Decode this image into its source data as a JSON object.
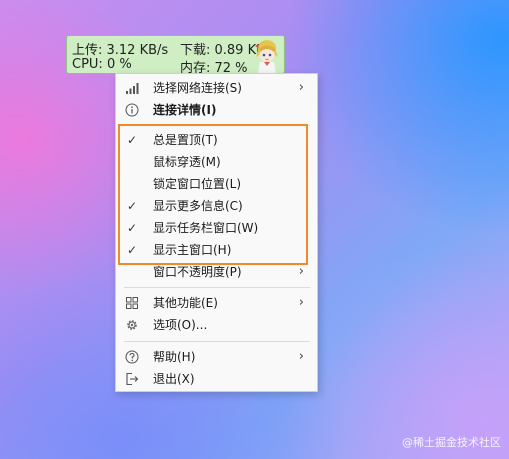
{
  "widget": {
    "upload": "上传: 3.12 KB/s",
    "download": "下载: 0.89 KB/s",
    "cpu": "CPU: 0 %",
    "memory": "内存: 72 %"
  },
  "menu": {
    "items": [
      {
        "label": "选择网络连接(S)",
        "icon": "signal-bars-icon",
        "submenu": true
      },
      {
        "label": "连接详情(I)",
        "icon": "info-icon",
        "bold": true
      },
      {
        "label": "总是置顶(T)",
        "checked": true
      },
      {
        "label": "鼠标穿透(M)",
        "checked": false
      },
      {
        "label": "锁定窗口位置(L)",
        "checked": false
      },
      {
        "label": "显示更多信息(C)",
        "checked": true
      },
      {
        "label": "显示任务栏窗口(W)",
        "checked": true
      },
      {
        "label": "显示主窗口(H)",
        "checked": true
      },
      {
        "label": "窗口不透明度(P)",
        "submenu": true
      },
      {
        "label": "其他功能(E)",
        "icon": "grid-icon",
        "submenu": true
      },
      {
        "label": "选项(O)...",
        "icon": "gear-icon"
      },
      {
        "label": "帮助(H)",
        "icon": "help-icon",
        "submenu": true
      },
      {
        "label": "退出(X)",
        "icon": "exit-icon"
      }
    ],
    "check_glyph": "✓",
    "arrow_glyph": "›"
  },
  "highlight_color": "#f08a2a",
  "watermark": "@稀土掘金技术社区"
}
